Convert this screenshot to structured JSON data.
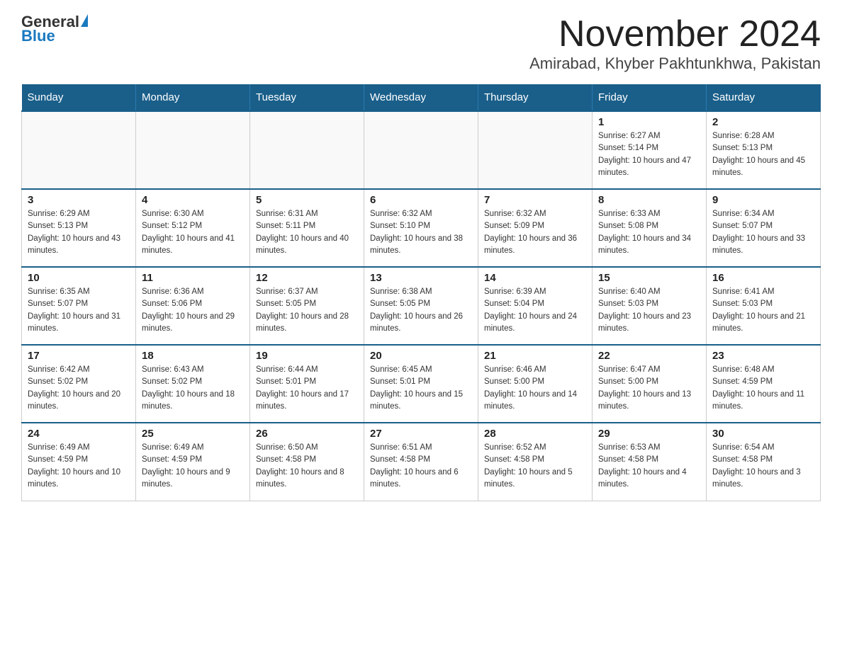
{
  "logo": {
    "text_general": "General",
    "text_blue": "Blue",
    "arrow_label": "general-blue-logo"
  },
  "header": {
    "month_year": "November 2024",
    "location": "Amirabad, Khyber Pakhtunkhwa, Pakistan"
  },
  "weekdays": [
    "Sunday",
    "Monday",
    "Tuesday",
    "Wednesday",
    "Thursday",
    "Friday",
    "Saturday"
  ],
  "weeks": [
    [
      {
        "day": "",
        "sunrise": "",
        "sunset": "",
        "daylight": ""
      },
      {
        "day": "",
        "sunrise": "",
        "sunset": "",
        "daylight": ""
      },
      {
        "day": "",
        "sunrise": "",
        "sunset": "",
        "daylight": ""
      },
      {
        "day": "",
        "sunrise": "",
        "sunset": "",
        "daylight": ""
      },
      {
        "day": "",
        "sunrise": "",
        "sunset": "",
        "daylight": ""
      },
      {
        "day": "1",
        "sunrise": "Sunrise: 6:27 AM",
        "sunset": "Sunset: 5:14 PM",
        "daylight": "Daylight: 10 hours and 47 minutes."
      },
      {
        "day": "2",
        "sunrise": "Sunrise: 6:28 AM",
        "sunset": "Sunset: 5:13 PM",
        "daylight": "Daylight: 10 hours and 45 minutes."
      }
    ],
    [
      {
        "day": "3",
        "sunrise": "Sunrise: 6:29 AM",
        "sunset": "Sunset: 5:13 PM",
        "daylight": "Daylight: 10 hours and 43 minutes."
      },
      {
        "day": "4",
        "sunrise": "Sunrise: 6:30 AM",
        "sunset": "Sunset: 5:12 PM",
        "daylight": "Daylight: 10 hours and 41 minutes."
      },
      {
        "day": "5",
        "sunrise": "Sunrise: 6:31 AM",
        "sunset": "Sunset: 5:11 PM",
        "daylight": "Daylight: 10 hours and 40 minutes."
      },
      {
        "day": "6",
        "sunrise": "Sunrise: 6:32 AM",
        "sunset": "Sunset: 5:10 PM",
        "daylight": "Daylight: 10 hours and 38 minutes."
      },
      {
        "day": "7",
        "sunrise": "Sunrise: 6:32 AM",
        "sunset": "Sunset: 5:09 PM",
        "daylight": "Daylight: 10 hours and 36 minutes."
      },
      {
        "day": "8",
        "sunrise": "Sunrise: 6:33 AM",
        "sunset": "Sunset: 5:08 PM",
        "daylight": "Daylight: 10 hours and 34 minutes."
      },
      {
        "day": "9",
        "sunrise": "Sunrise: 6:34 AM",
        "sunset": "Sunset: 5:07 PM",
        "daylight": "Daylight: 10 hours and 33 minutes."
      }
    ],
    [
      {
        "day": "10",
        "sunrise": "Sunrise: 6:35 AM",
        "sunset": "Sunset: 5:07 PM",
        "daylight": "Daylight: 10 hours and 31 minutes."
      },
      {
        "day": "11",
        "sunrise": "Sunrise: 6:36 AM",
        "sunset": "Sunset: 5:06 PM",
        "daylight": "Daylight: 10 hours and 29 minutes."
      },
      {
        "day": "12",
        "sunrise": "Sunrise: 6:37 AM",
        "sunset": "Sunset: 5:05 PM",
        "daylight": "Daylight: 10 hours and 28 minutes."
      },
      {
        "day": "13",
        "sunrise": "Sunrise: 6:38 AM",
        "sunset": "Sunset: 5:05 PM",
        "daylight": "Daylight: 10 hours and 26 minutes."
      },
      {
        "day": "14",
        "sunrise": "Sunrise: 6:39 AM",
        "sunset": "Sunset: 5:04 PM",
        "daylight": "Daylight: 10 hours and 24 minutes."
      },
      {
        "day": "15",
        "sunrise": "Sunrise: 6:40 AM",
        "sunset": "Sunset: 5:03 PM",
        "daylight": "Daylight: 10 hours and 23 minutes."
      },
      {
        "day": "16",
        "sunrise": "Sunrise: 6:41 AM",
        "sunset": "Sunset: 5:03 PM",
        "daylight": "Daylight: 10 hours and 21 minutes."
      }
    ],
    [
      {
        "day": "17",
        "sunrise": "Sunrise: 6:42 AM",
        "sunset": "Sunset: 5:02 PM",
        "daylight": "Daylight: 10 hours and 20 minutes."
      },
      {
        "day": "18",
        "sunrise": "Sunrise: 6:43 AM",
        "sunset": "Sunset: 5:02 PM",
        "daylight": "Daylight: 10 hours and 18 minutes."
      },
      {
        "day": "19",
        "sunrise": "Sunrise: 6:44 AM",
        "sunset": "Sunset: 5:01 PM",
        "daylight": "Daylight: 10 hours and 17 minutes."
      },
      {
        "day": "20",
        "sunrise": "Sunrise: 6:45 AM",
        "sunset": "Sunset: 5:01 PM",
        "daylight": "Daylight: 10 hours and 15 minutes."
      },
      {
        "day": "21",
        "sunrise": "Sunrise: 6:46 AM",
        "sunset": "Sunset: 5:00 PM",
        "daylight": "Daylight: 10 hours and 14 minutes."
      },
      {
        "day": "22",
        "sunrise": "Sunrise: 6:47 AM",
        "sunset": "Sunset: 5:00 PM",
        "daylight": "Daylight: 10 hours and 13 minutes."
      },
      {
        "day": "23",
        "sunrise": "Sunrise: 6:48 AM",
        "sunset": "Sunset: 4:59 PM",
        "daylight": "Daylight: 10 hours and 11 minutes."
      }
    ],
    [
      {
        "day": "24",
        "sunrise": "Sunrise: 6:49 AM",
        "sunset": "Sunset: 4:59 PM",
        "daylight": "Daylight: 10 hours and 10 minutes."
      },
      {
        "day": "25",
        "sunrise": "Sunrise: 6:49 AM",
        "sunset": "Sunset: 4:59 PM",
        "daylight": "Daylight: 10 hours and 9 minutes."
      },
      {
        "day": "26",
        "sunrise": "Sunrise: 6:50 AM",
        "sunset": "Sunset: 4:58 PM",
        "daylight": "Daylight: 10 hours and 8 minutes."
      },
      {
        "day": "27",
        "sunrise": "Sunrise: 6:51 AM",
        "sunset": "Sunset: 4:58 PM",
        "daylight": "Daylight: 10 hours and 6 minutes."
      },
      {
        "day": "28",
        "sunrise": "Sunrise: 6:52 AM",
        "sunset": "Sunset: 4:58 PM",
        "daylight": "Daylight: 10 hours and 5 minutes."
      },
      {
        "day": "29",
        "sunrise": "Sunrise: 6:53 AM",
        "sunset": "Sunset: 4:58 PM",
        "daylight": "Daylight: 10 hours and 4 minutes."
      },
      {
        "day": "30",
        "sunrise": "Sunrise: 6:54 AM",
        "sunset": "Sunset: 4:58 PM",
        "daylight": "Daylight: 10 hours and 3 minutes."
      }
    ]
  ]
}
